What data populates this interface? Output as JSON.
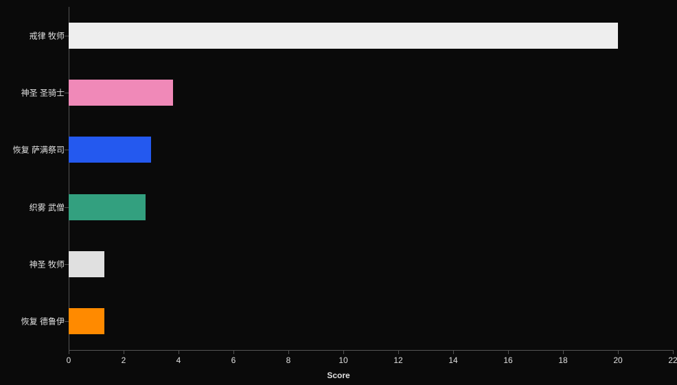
{
  "chart_data": {
    "type": "bar",
    "orientation": "horizontal",
    "categories": [
      "戒律 牧师",
      "神圣 圣骑士",
      "恢复 萨满祭司",
      "织雾 武僧",
      "神圣 牧师",
      "恢复 德鲁伊"
    ],
    "values": [
      20,
      3.8,
      3,
      2.8,
      1.3,
      1.3
    ],
    "colors": [
      "#eeeeee",
      "#f089b8",
      "#2459ef",
      "#33a07f",
      "#e0e0e0",
      "#ff8a00"
    ],
    "xlabel": "Score",
    "ylabel": "",
    "xlim": [
      0,
      22
    ],
    "x_ticks": [
      0,
      2,
      4,
      6,
      8,
      10,
      12,
      14,
      16,
      18,
      20,
      22
    ]
  }
}
